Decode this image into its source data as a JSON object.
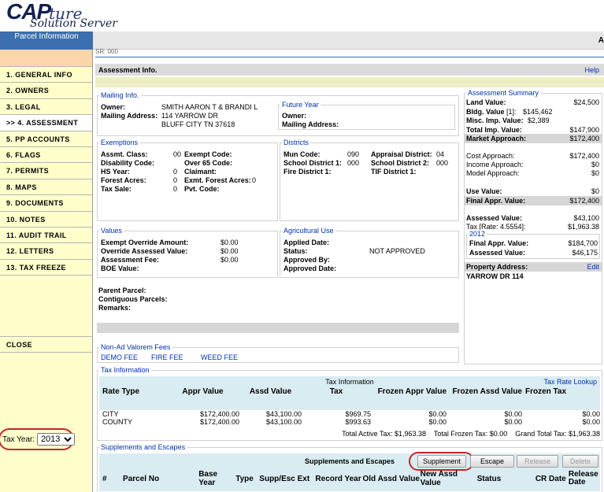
{
  "logo": {
    "cap": "CAP",
    "ture": "ture",
    "sub": "Solution Server"
  },
  "header": {
    "tab_label": "Parcel Information",
    "right_char": "A",
    "sr": "SR: 000"
  },
  "nav": [
    "1. GENERAL INFO",
    "2. OWNERS",
    "3. LEGAL",
    ">> 4. ASSESSMENT",
    "5. PP ACCOUNTS",
    "6. FLAGS",
    "7. PERMITS",
    "8. MAPS",
    "9. DOCUMENTS",
    "10. NOTES",
    "11. AUDIT TRAIL",
    "12. LETTERS",
    "13. TAX FREEZE"
  ],
  "close_label": "CLOSE",
  "tax_year": {
    "label": "Tax Year:",
    "value": "2013"
  },
  "assessment": {
    "title": "Assessment Info.",
    "help": "Help"
  },
  "mailing": {
    "legend": "Mailing Info.",
    "owner_label": "Owner:",
    "owner": "SMITH AARON T & BRANDI L",
    "addr_label": "Mailing Address:",
    "addr1": "114 YARROW DR",
    "addr2": "BLUFF CITY TN 37618"
  },
  "future": {
    "legend": "Future Year",
    "owner_label": "Owner:",
    "addr_label": "Mailing Address:"
  },
  "exemptions": {
    "legend": "Exemptions",
    "assmt_class_label": "Assmt. Class:",
    "assmt_class": "00",
    "disability_label": "Disability Code:",
    "hs_year_label": "HS Year:",
    "hs_year": "0",
    "forest_label": "Forest Acres:",
    "forest": "0",
    "tax_sale_label": "Tax Sale:",
    "tax_sale": "0",
    "exempt_code_label": "Exempt Code:",
    "over65_label": "Over 65 Code:",
    "claimant_label": "Claimant:",
    "exmt_forest_label": "Exmt. Forest Acres:",
    "exmt_forest": "0",
    "pvt_code_label": "Pvt. Code:"
  },
  "districts": {
    "legend": "Districts",
    "mun_label": "Mun Code:",
    "mun": "090",
    "school1_label": "School District 1:",
    "school1": "000",
    "fire1_label": "Fire District 1:",
    "appraisal_label": "Appraisal District:",
    "appraisal": "04",
    "school2_label": "School District 2:",
    "school2": "000",
    "tif_label": "TIF District 1:"
  },
  "values": {
    "legend": "Values",
    "exempt_override_label": "Exempt Override Amount:",
    "exempt_override": "$0.00",
    "override_assessed_label": "Override Assessed Value:",
    "override_assessed": "$0.00",
    "assessment_fee_label": "Assessment Fee:",
    "assessment_fee": "$0.00",
    "boe_label": "BOE Value:"
  },
  "agri": {
    "legend": "Agricultural Use",
    "applied_label": "Applied Date:",
    "status_label": "Status:",
    "status": "NOT APPROVED",
    "approved_by_label": "Approved By:",
    "approved_date_label": "Approved Date:"
  },
  "parent": {
    "parent_label": "Parent Parcel:",
    "contiguous_label": "Contiguous Parcels:",
    "remarks_label": "Remarks:"
  },
  "summary": {
    "legend": "Assessment Summary",
    "land_label": "Land Value:",
    "land": "$24,500",
    "bldg_label": "Bldg. Value",
    "bldg_count": "[1]:",
    "bldg": "$145,462",
    "misc_label": "Misc. Imp. Value:",
    "misc": "$2,389",
    "total_imp_label": "Total Imp. Value:",
    "total_imp": "$147,900",
    "market_label": "Market Approach:",
    "market": "$172,400",
    "cost_label": "Cost Approach:",
    "cost": "$172,400",
    "income_label": "Income Approach:",
    "income": "$0",
    "model_label": "Model Approach:",
    "model": "$0",
    "use_label": "Use Value:",
    "use": "$0",
    "final_label": "Final Appr. Value:",
    "final": "$172,400",
    "assessed_label": "Assessed Value:",
    "assessed": "$43,100",
    "tax_label": "Tax [Rate: 4.5554]:",
    "tax": "$1,963.38",
    "prev_year": "2012",
    "prev_final_label": "Final Appr. Value:",
    "prev_final": "$184,700",
    "prev_assessed_label": "Assessed Value:",
    "prev_assessed": "$46,175",
    "prop_addr_label": "Property Address:",
    "edit": "Edit",
    "prop_addr": "YARROW DR 114"
  },
  "nonadval": {
    "legend": "Non-Ad Valorem Fees",
    "fees": [
      "DEMO FEE",
      "FIRE FEE",
      "WEED FEE"
    ]
  },
  "taxinfo": {
    "legend": "Tax Information",
    "title": "Tax Information",
    "lookup": "Tax Rate Lookup",
    "headers": [
      "Rate Type",
      "Appr Value",
      "Assd Value",
      "Tax",
      "Frozen Appr Value",
      "Frozen Assd Value",
      "Frozen Tax"
    ],
    "rows": [
      [
        "CITY",
        "$172,400.00",
        "$43,100.00",
        "$969.75",
        "$0.00",
        "$0.00",
        "$0.00"
      ],
      [
        "COUNTY",
        "$172,400.00",
        "$43,100.00",
        "$993.63",
        "$0.00",
        "$0.00",
        "$0.00"
      ]
    ],
    "totals": "Total Active Tax: $1,963.38    Total Frozen Tax: $0.00    Grand Total Tax: $1,963.38"
  },
  "supp": {
    "legend": "Supplements and Escapes",
    "title": "Supplements and Escapes",
    "buttons": {
      "supplement": "Supplement",
      "escape": "Escape",
      "release": "Release",
      "delete": "Delete"
    },
    "headers": [
      "#",
      "Parcel No",
      "Base Year",
      "Type",
      "Supp/Esc Ext",
      "Record Year",
      "Old Assd Value",
      "New Assd Value",
      "Status",
      "CR Date",
      "Release Date"
    ]
  },
  "colors": {
    "nav_bg": "#ffffcc",
    "tab_blue": "#3c6fae",
    "highlight_red": "#c0272d",
    "link_blue": "#0033aa"
  }
}
